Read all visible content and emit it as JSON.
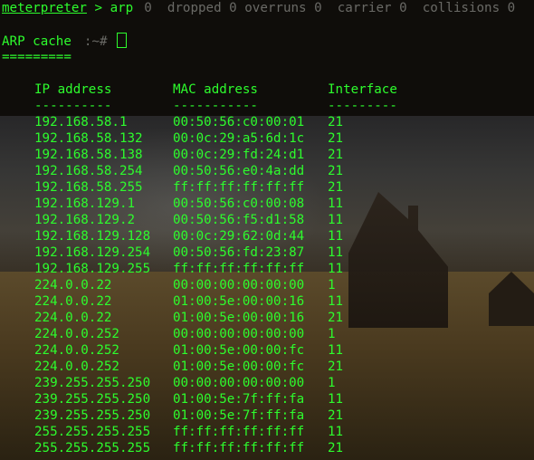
{
  "terminal": {
    "prompt_user": "meterpreter",
    "prompt_rest": " > arp",
    "bleed_text": "0  dropped 0 overruns 0  carrier 0  collisions 0",
    "title": "ARP cache",
    "bleed_prompt": ":~# ",
    "underline": "========="
  },
  "table": {
    "headers": {
      "ip": "IP address",
      "mac": "MAC address",
      "iface": "Interface"
    },
    "dividers": {
      "ip": "----------",
      "mac": "-----------",
      "iface": "---------"
    },
    "rows": [
      {
        "ip": "192.168.58.1",
        "mac": "00:50:56:c0:00:01",
        "iface": "21"
      },
      {
        "ip": "192.168.58.132",
        "mac": "00:0c:29:a5:6d:1c",
        "iface": "21"
      },
      {
        "ip": "192.168.58.138",
        "mac": "00:0c:29:fd:24:d1",
        "iface": "21"
      },
      {
        "ip": "192.168.58.254",
        "mac": "00:50:56:e0:4a:dd",
        "iface": "21"
      },
      {
        "ip": "192.168.58.255",
        "mac": "ff:ff:ff:ff:ff:ff",
        "iface": "21"
      },
      {
        "ip": "192.168.129.1",
        "mac": "00:50:56:c0:00:08",
        "iface": "11"
      },
      {
        "ip": "192.168.129.2",
        "mac": "00:50:56:f5:d1:58",
        "iface": "11"
      },
      {
        "ip": "192.168.129.128",
        "mac": "00:0c:29:62:0d:44",
        "iface": "11"
      },
      {
        "ip": "192.168.129.254",
        "mac": "00:50:56:fd:23:87",
        "iface": "11"
      },
      {
        "ip": "192.168.129.255",
        "mac": "ff:ff:ff:ff:ff:ff",
        "iface": "11"
      },
      {
        "ip": "224.0.0.22",
        "mac": "00:00:00:00:00:00",
        "iface": "1"
      },
      {
        "ip": "224.0.0.22",
        "mac": "01:00:5e:00:00:16",
        "iface": "11"
      },
      {
        "ip": "224.0.0.22",
        "mac": "01:00:5e:00:00:16",
        "iface": "21"
      },
      {
        "ip": "224.0.0.252",
        "mac": "00:00:00:00:00:00",
        "iface": "1"
      },
      {
        "ip": "224.0.0.252",
        "mac": "01:00:5e:00:00:fc",
        "iface": "11"
      },
      {
        "ip": "224.0.0.252",
        "mac": "01:00:5e:00:00:fc",
        "iface": "21"
      },
      {
        "ip": "239.255.255.250",
        "mac": "00:00:00:00:00:00",
        "iface": "1"
      },
      {
        "ip": "239.255.255.250",
        "mac": "01:00:5e:7f:ff:fa",
        "iface": "11"
      },
      {
        "ip": "239.255.255.250",
        "mac": "01:00:5e:7f:ff:fa",
        "iface": "21"
      },
      {
        "ip": "255.255.255.255",
        "mac": "ff:ff:ff:ff:ff:ff",
        "iface": "11"
      },
      {
        "ip": "255.255.255.255",
        "mac": "ff:ff:ff:ff:ff:ff",
        "iface": "21"
      }
    ]
  }
}
